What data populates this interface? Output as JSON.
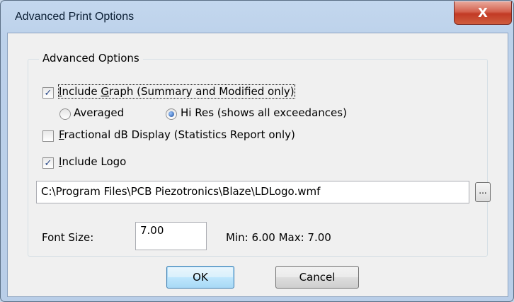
{
  "window": {
    "title": "Advanced Print Options",
    "close_glyph": "X"
  },
  "group": {
    "label": "Advanced Options"
  },
  "include_graph": {
    "checked": true,
    "label_prefix": "",
    "mnemonic": "I",
    "label_rest": "nclude ",
    "mnemonic2": "G",
    "label_suffix": "raph (Summary and Modified only)"
  },
  "graph_mode": {
    "options": [
      {
        "label": "Averaged",
        "selected": false
      },
      {
        "label": "Hi Res (shows all exceedances)",
        "selected": true
      }
    ]
  },
  "fractional_db": {
    "checked": false,
    "mnemonic": "F",
    "label_rest": "ractional dB Display (Statistics Report only)"
  },
  "include_logo": {
    "checked": true,
    "mnemonic": "I",
    "label_rest": "nclude Logo"
  },
  "logo_path": {
    "value": "C:\\Program Files\\PCB Piezotronics\\Blaze\\LDLogo.wmf"
  },
  "browse_button": {
    "label": "..."
  },
  "font_size": {
    "label": "Font Size:",
    "value": "7.00",
    "range_text": "Min: 6.00  Max: 7.00"
  },
  "buttons": {
    "ok": "OK",
    "cancel": "Cancel"
  },
  "colors": {
    "titlebar": "#c3d7ee",
    "client": "#f0f0f0",
    "close_button": "#c23a25"
  }
}
